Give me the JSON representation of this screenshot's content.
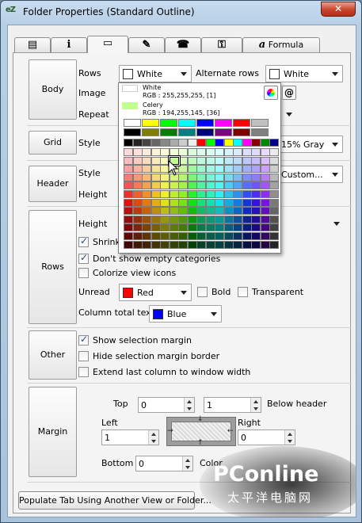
{
  "window": {
    "title": "Folder Properties (Standard Outline)",
    "close": "✕",
    "app_icon": "eZ"
  },
  "tabs": [
    {
      "icon": "list-icon",
      "glyph": "▤",
      "label": ""
    },
    {
      "icon": "info-icon",
      "glyph": "i",
      "label": ""
    },
    {
      "icon": "color-panel-icon",
      "glyph": "▭",
      "label": ""
    },
    {
      "icon": "pen-icon",
      "glyph": "✎",
      "label": ""
    },
    {
      "icon": "phone-icon",
      "glyph": "☎",
      "label": ""
    },
    {
      "icon": "key-icon",
      "glyph": "⚿",
      "label": ""
    },
    {
      "icon": "formula-icon",
      "glyph": "a",
      "label": "Formula"
    }
  ],
  "sections": {
    "body": "Body",
    "grid": "Grid",
    "header": "Header",
    "rows": "Rows",
    "other": "Other",
    "margin": "Margin"
  },
  "body_section": {
    "rows_label": "Rows",
    "rows_value": "White",
    "rows_color": "#ffffff",
    "alternate_label": "Alternate rows",
    "alternate_value": "White",
    "alternate_color": "#ffffff",
    "image_label": "Image",
    "image_button": "@",
    "repeat_label": "Repeat"
  },
  "grid_section": {
    "style_label": "Style",
    "style_value": "15% Gray"
  },
  "header_section": {
    "style_label": "Style",
    "style_value": "Custom...",
    "height_label": "Height"
  },
  "rows_section": {
    "height_label": "Height",
    "shrink_label": "Shrink",
    "dont_show_empty": "Don't show empty categories",
    "colorize_icons": "Colorize view icons",
    "unread_label": "Unread",
    "unread_value": "Red",
    "unread_color": "#ff0000",
    "bold_label": "Bold",
    "transparent_label": "Transparent",
    "column_total_label": "Column total text",
    "column_total_value": "Blue",
    "column_total_color": "#0000ff"
  },
  "other_section": {
    "show_margin": "Show selection margin",
    "hide_margin_border": "Hide selection margin border",
    "extend_last_column": "Extend last column to window width"
  },
  "margin_section": {
    "top_label": "Top",
    "top_value": "0",
    "below_header_value": "1",
    "below_header_label": "Below header",
    "left_label": "Left",
    "left_value": "1",
    "right_label": "Right",
    "right_value": "0",
    "bottom_label": "Bottom",
    "bottom_value": "0",
    "color_label": "Color"
  },
  "populate_button": "Populate Tab Using Another View or Folder...",
  "color_picker": {
    "current_name": "White",
    "current_rgb": "RGB : 255,255,255, [1]",
    "current_color": "#ffffff",
    "hover_name": "Celery",
    "hover_rgb": "RGB : 194,255,145, [36]",
    "hover_color": "#c2ff91",
    "wheel_icon": "color-wheel-icon",
    "at_icon": "@"
  },
  "watermark": {
    "brand": "PConline",
    "cn": "太平洋电脑网"
  },
  "ui_colors": {
    "window_frame": "#b7cfe6",
    "close": "#c7432b",
    "panel": "#f4f4f4"
  }
}
